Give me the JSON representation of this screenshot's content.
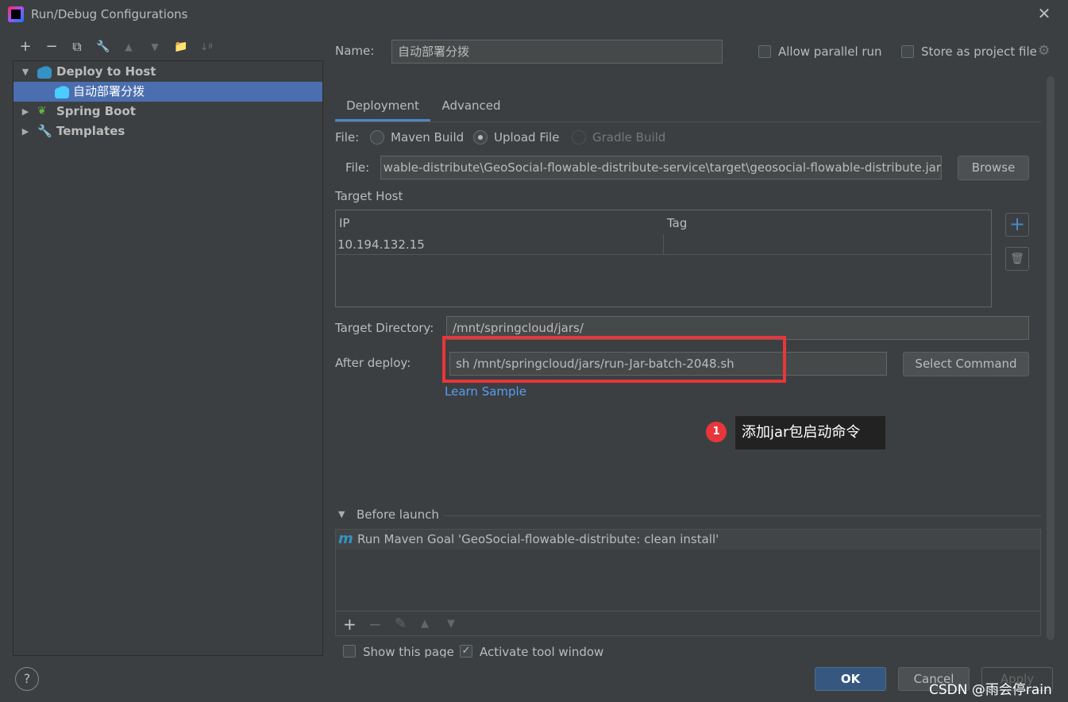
{
  "window": {
    "title": "Run/Debug Configurations",
    "close_glyph": "✕"
  },
  "toolbar": {
    "add": "+",
    "remove": "−",
    "copy": "⧉",
    "edit": "🔧",
    "up": "▲",
    "down": "▼",
    "folder": "📁",
    "sort": "↓ª"
  },
  "tree": {
    "items": [
      {
        "label": "Deploy to Host",
        "expanded": true,
        "icon": "cloud-icon"
      },
      {
        "label": "自动部署分拨",
        "selected": true,
        "icon": "cloud-icon"
      },
      {
        "label": "Spring Boot",
        "expanded": false,
        "icon": "spring-boot-icon"
      },
      {
        "label": "Templates",
        "expanded": false,
        "icon": "wrench-icon"
      }
    ]
  },
  "form": {
    "name_label": "Name:",
    "name_value": "自动部署分拨",
    "allow_parallel_label": "Allow parallel run",
    "store_project_label": "Store as project file",
    "tabs": [
      "Deployment",
      "Advanced"
    ],
    "file_source_label": "File:",
    "file_options": [
      "Maven Build",
      "Upload File",
      "Gradle Build"
    ],
    "file_path_label": "File:",
    "file_path_value": "wable-distribute\\GeoSocial-flowable-distribute-service\\target\\geosocial-flowable-distribute.jar",
    "browse_label": "Browse",
    "target_host_label": "Target Host",
    "host_table": {
      "columns": [
        "IP",
        "Tag"
      ],
      "rows": [
        {
          "ip": "10.194.132.15",
          "tag": ""
        }
      ]
    },
    "add_host": "+",
    "delete_host": "🗑",
    "target_dir_label": "Target Directory:",
    "target_dir_value": "/mnt/springcloud/jars/",
    "after_deploy_label": "After deploy:",
    "after_deploy_value": "sh /mnt/springcloud/jars/run-Jar-batch-2048.sh",
    "select_command_label": "Select Command",
    "learn_sample_label": "Learn Sample"
  },
  "annotation": {
    "badge": "1",
    "text": "添加jar包启动命令"
  },
  "before_launch": {
    "title": "Before launch",
    "item": "Run Maven Goal 'GeoSocial-flowable-distribute: clean install'",
    "maven_glyph": "m",
    "tools": {
      "add": "+",
      "remove": "−",
      "edit": "✎",
      "up": "▲",
      "down": "▼"
    }
  },
  "footer": {
    "show_page_label": "Show this page",
    "activate_tool_label": "Activate tool window",
    "help": "?",
    "ok_label": "OK",
    "cancel_label": "Cancel",
    "apply_label": "Apply"
  },
  "watermark": "CSDN @雨会停rain"
}
